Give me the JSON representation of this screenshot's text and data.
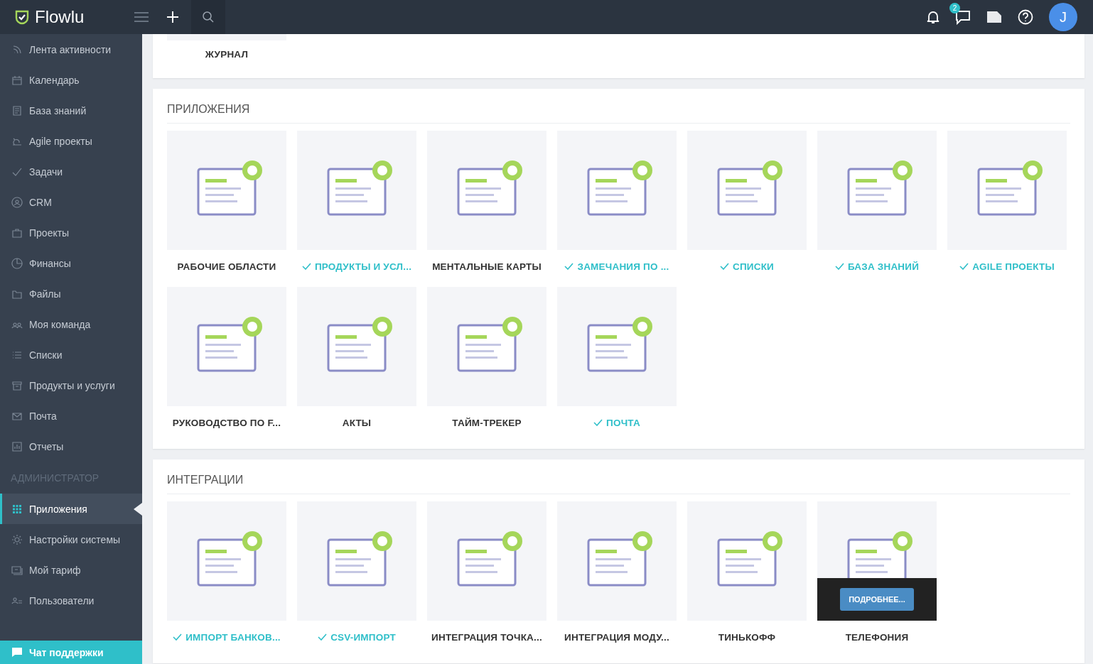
{
  "topbar": {
    "logo": "Flowlu",
    "notifications_badge": "2",
    "avatar": "J"
  },
  "sidebar": {
    "items": [
      {
        "label": "Лента активности",
        "selected": false
      },
      {
        "label": "Календарь",
        "selected": false
      },
      {
        "label": "База знаний",
        "selected": false
      },
      {
        "label": "Agile проекты",
        "selected": false
      },
      {
        "label": "Задачи",
        "selected": false
      },
      {
        "label": "CRM",
        "selected": false
      },
      {
        "label": "Проекты",
        "selected": false
      },
      {
        "label": "Финансы",
        "selected": false
      },
      {
        "label": "Файлы",
        "selected": false
      },
      {
        "label": "Моя команда",
        "selected": false
      },
      {
        "label": "Списки",
        "selected": false
      },
      {
        "label": "Продукты и услуги",
        "selected": false
      },
      {
        "label": "Почта",
        "selected": false
      },
      {
        "label": "Отчеты",
        "selected": false
      }
    ],
    "admin_title": "АДМИНИСТРАТОР",
    "admin_items": [
      {
        "label": "Приложения",
        "selected": true
      },
      {
        "label": "Настройки системы",
        "selected": false
      },
      {
        "label": "Мой тариф",
        "selected": false
      },
      {
        "label": "Пользователи",
        "selected": false
      }
    ],
    "support_button": "Чат поддержки"
  },
  "journal": {
    "label": "ЖУРНАЛ"
  },
  "sections": [
    {
      "title": "ПРИЛОЖЕНИЯ",
      "tiles": [
        {
          "label": "РАБОЧИЕ ОБЛАСТИ",
          "installed": false
        },
        {
          "label": "ПРОДУКТЫ И УСЛ...",
          "installed": true
        },
        {
          "label": "МЕНТАЛЬНЫЕ КАРТЫ",
          "installed": false
        },
        {
          "label": "ЗАМЕЧАНИЯ ПО ...",
          "installed": true
        },
        {
          "label": "СПИСКИ",
          "installed": true
        },
        {
          "label": "БАЗА ЗНАНИЙ",
          "installed": true
        },
        {
          "label": "AGILE ПРОЕКТЫ",
          "installed": true
        },
        {
          "label": "РУКОВОДСТВО ПО F...",
          "installed": false
        },
        {
          "label": "АКТЫ",
          "installed": false
        },
        {
          "label": "ТАЙМ-ТРЕКЕР",
          "installed": false
        },
        {
          "label": "ПОЧТА",
          "installed": true
        }
      ]
    },
    {
      "title": "ИНТЕГРАЦИИ",
      "tiles": [
        {
          "label": "ИМПОРТ БАНКОВ...",
          "installed": true
        },
        {
          "label": "CSV-ИМПОРТ",
          "installed": true
        },
        {
          "label": "ИНТЕГРАЦИЯ ТОЧКА...",
          "installed": false
        },
        {
          "label": "ИНТЕГРАЦИЯ МОДУ...",
          "installed": false
        },
        {
          "label": "ТИНЬКОФФ",
          "installed": false
        },
        {
          "label": "ТЕЛЕФОНИЯ",
          "installed": false,
          "more_button": "ПОДРОБНЕЕ..."
        }
      ]
    }
  ]
}
